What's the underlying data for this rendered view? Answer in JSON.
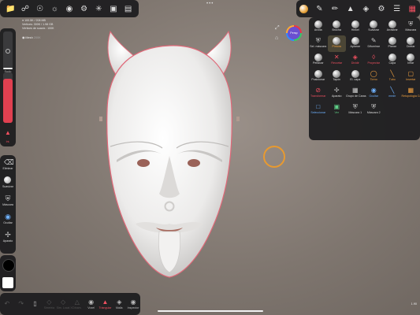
{
  "app": {
    "stats_line1": "● 100.5K / 208 MB",
    "stats_line2": "Vertices: 300K / 1.98 GB",
    "stats_line3": "Vértices de suaviz.: 100K",
    "mesh_label": "Mesh",
    "mesh_sub": "200K",
    "version": "1.90",
    "perspective_label": "Persp"
  },
  "top_left_icons": [
    "folder-icon",
    "share-icon",
    "scene-icon",
    "camera-icon",
    "globe-icon",
    "settings-icon",
    "sun-icon",
    "image-icon",
    "film-icon"
  ],
  "top_right_icons": [
    "material-icon",
    "pencil-icon",
    "brush-icon",
    "triangle-icon",
    "layers-icon",
    "gear-icon",
    "list-icon",
    "grid-icon"
  ],
  "left": {
    "radius_label": "Radio",
    "intensity_label": "Int.",
    "radius_value": 0.04,
    "intensity_value": 0.88
  },
  "left_tools": [
    {
      "name": "eraser-icon",
      "label": "Eliminar"
    },
    {
      "name": "smooth-icon",
      "label": "Suavizar"
    },
    {
      "name": "mask-icon",
      "label": "Máscara"
    },
    {
      "name": "hide-icon",
      "label": "Ocultar"
    },
    {
      "name": "gizmo-icon",
      "label": "Aparato"
    }
  ],
  "swatches": {
    "primary": "#000000",
    "secondary": "#ffffff"
  },
  "tools": [
    {
      "icon": "clay",
      "label": "Arcilla",
      "color": ""
    },
    {
      "icon": "brush",
      "label": "Brocha",
      "color": ""
    },
    {
      "icon": "move",
      "label": "Hinkel",
      "color": ""
    },
    {
      "icon": "smooth",
      "label": "Suavizar",
      "color": ""
    },
    {
      "icon": "drag",
      "label": "Arrastrar",
      "color": ""
    },
    {
      "icon": "mask",
      "label": "Máscara",
      "color": ""
    },
    {
      "icon": "selmask",
      "label": "Sel. máscara",
      "color": ""
    },
    {
      "icon": "paint",
      "label": "Pintura",
      "color": "orange"
    },
    {
      "icon": "flatten",
      "label": "Aplanar",
      "color": ""
    },
    {
      "icon": "blur",
      "label": "Difuminar",
      "color": ""
    },
    {
      "icon": "planar",
      "label": "Planar",
      "color": ""
    },
    {
      "icon": "fold",
      "label": "Doblar",
      "color": ""
    },
    {
      "icon": "pinch",
      "label": "Pellizcar",
      "color": ""
    },
    {
      "icon": "crease",
      "label": "Recortar",
      "color": "red"
    },
    {
      "icon": "divide",
      "label": "Dividir",
      "color": "red"
    },
    {
      "icon": "project",
      "label": "Proyectar",
      "color": "red"
    },
    {
      "icon": "layer",
      "label": "Capa",
      "color": ""
    },
    {
      "icon": "inflate",
      "label": "Inflar",
      "color": ""
    },
    {
      "icon": "pose",
      "label": "Posicionar",
      "color": ""
    },
    {
      "icon": "stamp",
      "label": "Tapón",
      "color": ""
    },
    {
      "icon": "ellayer",
      "label": "El. capa",
      "color": ""
    },
    {
      "icon": "lathe",
      "label": "Torno",
      "color": "orange"
    },
    {
      "icon": "tube",
      "label": "Tubo",
      "color": "orange"
    },
    {
      "icon": "insert",
      "label": "Insertar",
      "color": "orange"
    },
    {
      "icon": "transform",
      "label": "Transformar",
      "color": "red"
    },
    {
      "icon": "gizmo",
      "label": "Aparato",
      "color": ""
    },
    {
      "icon": "facegroup",
      "label": "Grupo de Caras",
      "color": ""
    },
    {
      "icon": "hide",
      "label": "Ocultar",
      "color": "blue"
    },
    {
      "icon": "measure",
      "label": "medir",
      "color": "blue"
    },
    {
      "icon": "retopo",
      "label": "Retopología Construcción",
      "color": "orange"
    },
    {
      "icon": "select",
      "label": "Seleccionar",
      "color": "blue"
    },
    {
      "icon": "view",
      "label": "Ver",
      "color": "green"
    },
    {
      "icon": "mask1",
      "label": "Máscara 1",
      "color": ""
    },
    {
      "icon": "mask2",
      "label": "Máscara 2",
      "color": ""
    }
  ],
  "bottom_tools": [
    {
      "name": "undo-icon",
      "label": "",
      "state": "dim"
    },
    {
      "name": "redo-icon",
      "label": "",
      "state": "dim"
    },
    {
      "name": "tablet-icon",
      "label": "",
      "state": ""
    },
    {
      "name": "symmetry-icon",
      "label": "Simetría",
      "state": "dim"
    },
    {
      "name": "mirror-icon",
      "label": "Sim. Local X",
      "state": "dim"
    },
    {
      "name": "dynamic-icon",
      "label": "Dinam.",
      "state": "dim"
    },
    {
      "name": "voxel-icon",
      "label": "Voxel",
      "state": ""
    },
    {
      "name": "triangle-icon",
      "label": "Triangular",
      "state": "active"
    },
    {
      "name": "mesh-icon",
      "label": "Malla",
      "state": ""
    },
    {
      "name": "inspector-icon",
      "label": "Inspector",
      "state": ""
    }
  ]
}
